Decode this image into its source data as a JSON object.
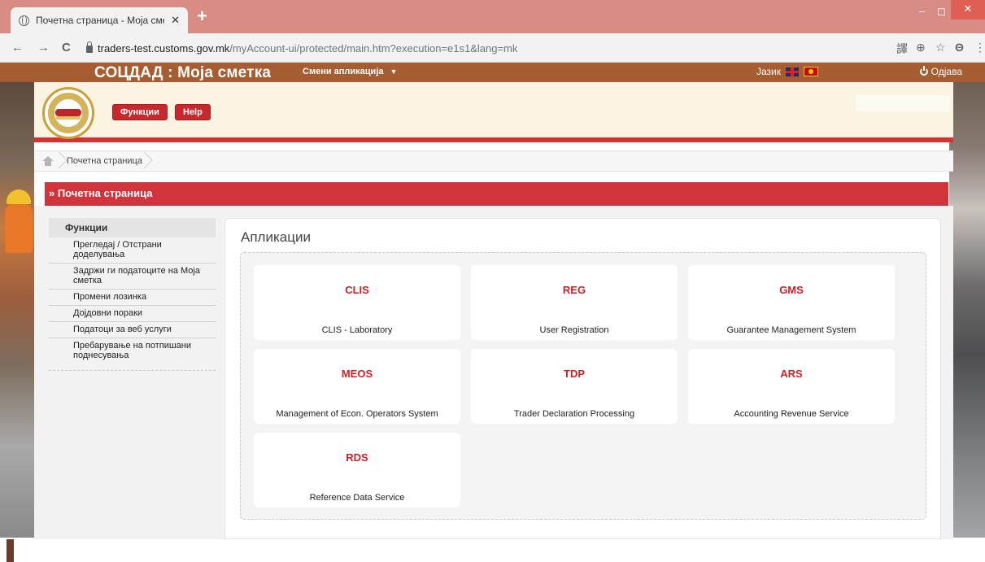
{
  "browser": {
    "tab_title": "Почетна страница - Моја сметк",
    "tab_close": "✕",
    "new_tab": "+",
    "url_host": "traders-test.customs.gov.mk",
    "url_path": "/myAccount-ui/protected/main.htm?execution=e1s1&lang=mk",
    "back": "←",
    "forward": "→",
    "reload": "C",
    "minimize": "–",
    "restore": "◻",
    "close": "✕",
    "translate": "譯",
    "zoom": "⊕",
    "star": "☆",
    "profile": "Θ",
    "menu": "⋮"
  },
  "topbar": {
    "brand": "СОЦДАД : Моја сметка",
    "switch_app": "Смени апликација",
    "switch_caret": "▼",
    "language_label": "Јазик",
    "logout": "Одјава"
  },
  "header": {
    "functions_button": "Функции",
    "help_button": "Help"
  },
  "breadcrumb": {
    "current": "Почетна страница"
  },
  "page_title": "» Почетна страница",
  "sidebar": {
    "heading": "Функции",
    "items": [
      {
        "label": "Прегледај / Отстрани доделувања"
      },
      {
        "label": "Задржи ги податоците на Моја сметка"
      },
      {
        "label": "Промени лозинка"
      },
      {
        "label": "Дојдовни пораки"
      },
      {
        "label": "Податоци за веб услуги"
      },
      {
        "label": "Пребарување на потпишани поднесувања"
      }
    ]
  },
  "applications": {
    "title": "Апликации",
    "items": [
      {
        "code": "CLIS",
        "name": "CLIS - Laboratory"
      },
      {
        "code": "REG",
        "name": "User Registration"
      },
      {
        "code": "GMS",
        "name": "Guarantee Management System"
      },
      {
        "code": "MEOS",
        "name": "Management of Econ. Operators System"
      },
      {
        "code": "TDP",
        "name": "Trader Declaration Processing"
      },
      {
        "code": "ARS",
        "name": "Accounting Revenue Service"
      },
      {
        "code": "RDS",
        "name": "Reference Data Service"
      }
    ]
  },
  "colors": {
    "topbar": "#a65d31",
    "accent_red": "#d1343a",
    "app_code": "#d21e26",
    "header_bg": "#fbf4e3"
  },
  "icons": {
    "tab": "globe-icon",
    "home": "home-icon",
    "logout": "power-icon",
    "secure": "lock-icon"
  }
}
